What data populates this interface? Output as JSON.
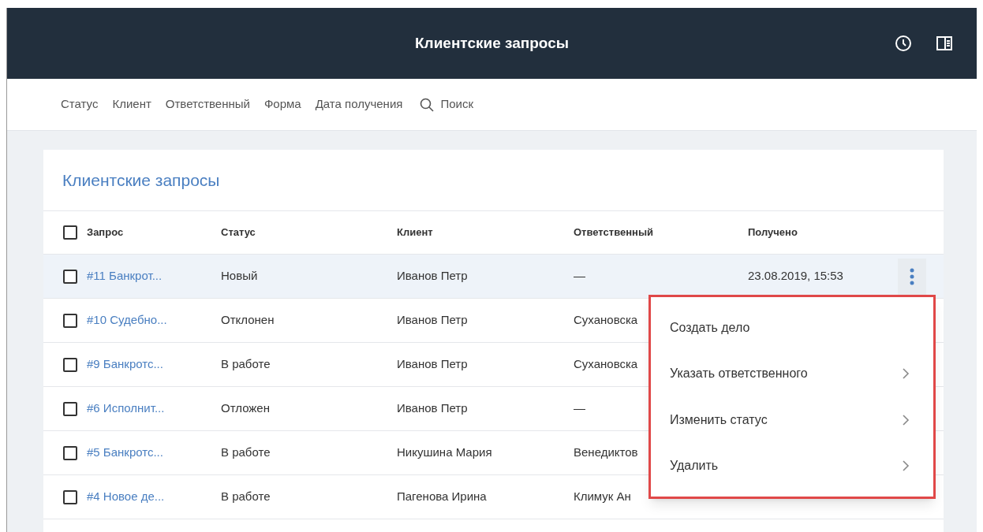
{
  "header": {
    "title": "Клиентские запросы"
  },
  "filters": [
    {
      "label": "Статус"
    },
    {
      "label": "Клиент"
    },
    {
      "label": "Ответственный"
    },
    {
      "label": "Форма"
    },
    {
      "label": "Дата получения"
    }
  ],
  "search": {
    "placeholder": "Поиск"
  },
  "card": {
    "title": "Клиентские запросы"
  },
  "table": {
    "columns": [
      "Запрос",
      "Статус",
      "Клиент",
      "Ответственный",
      "Получено"
    ],
    "select_all": {
      "checked": false
    },
    "rows": [
      {
        "id": "#11 Банкрот...",
        "status": "Новый",
        "client": "Иванов Петр",
        "responsible": "—",
        "received": "23.08.2019, 15:53",
        "checked": false,
        "highlighted": true
      },
      {
        "id": "#10 Судебно...",
        "status": "Отклонен",
        "client": "Иванов Петр",
        "responsible": "Сухановска",
        "checked": false,
        "highlighted": false
      },
      {
        "id": "#9 Банкротс...",
        "status": "В работе",
        "client": "Иванов Петр",
        "responsible": "Сухановска",
        "checked": false,
        "highlighted": false
      },
      {
        "id": "#6 Исполнит...",
        "status": "Отложен",
        "client": "Иванов Петр",
        "responsible": "—",
        "checked": false,
        "highlighted": false
      },
      {
        "id": "#5 Банкротс...",
        "status": "В работе",
        "client": "Никушина Мария",
        "responsible": "Венедиктов",
        "checked": false,
        "highlighted": false
      },
      {
        "id": "#4 Новое де...",
        "status": "В работе",
        "client": "Пагенова Ирина",
        "responsible": "Климук Ан",
        "checked": false,
        "highlighted": false
      }
    ]
  },
  "context_menu": {
    "items": [
      {
        "label": "Создать дело",
        "submenu": false
      },
      {
        "label": "Указать ответственного",
        "submenu": true
      },
      {
        "label": "Изменить статус",
        "submenu": true
      },
      {
        "label": "Удалить",
        "submenu": true
      }
    ]
  }
}
